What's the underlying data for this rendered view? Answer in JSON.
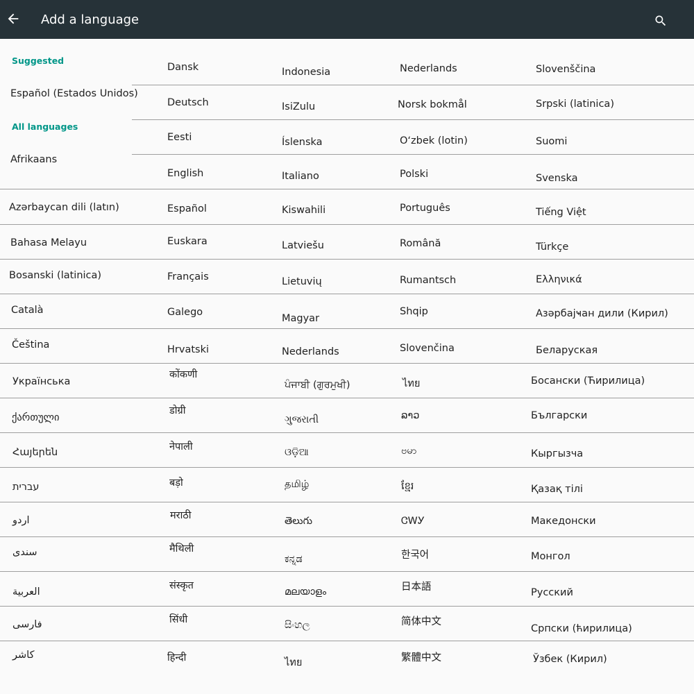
{
  "appbar": {
    "title": "Add a language",
    "back_icon": "arrow-back-icon",
    "search_icon": "search-icon",
    "background": "#263238"
  },
  "sections": {
    "suggested": "Suggested",
    "all": "All languages"
  },
  "suggested_items": [
    "Español (Estados Unidos)"
  ],
  "col0": [
    "Afrikaans",
    "Azərbaycan dili (latın)",
    "Bahasa Melayu",
    "Bosanski (latinica)",
    "Català",
    "Čeština",
    "Українська",
    "ქართული",
    "Հայերեն",
    "עברית",
    "اردو",
    "سندی",
    "العربية",
    "فارسی",
    "کاشر"
  ],
  "col1": [
    "Dansk",
    "Deutsch",
    "Eesti",
    "English",
    "Español",
    "Euskara",
    "Français",
    "Galego",
    "Hrvatski",
    "कोंकणी",
    "डोग्री",
    "नेपाली",
    "बड़ो",
    "मराठी",
    "मैथिली",
    "संस्कृत",
    "सिंधी",
    "हिन्दी"
  ],
  "col2": [
    "Indonesia",
    "IsiZulu",
    "Íslenska",
    "Italiano",
    "Kiswahili",
    "Latviešu",
    "Lietuvių",
    "Magyar",
    "Nederlands",
    "ਪੰਜਾਬੀ (ਗੁਰਮੁਖੀ)",
    "ગુજરાતી",
    "ଓଡ଼ିଆ",
    "தமிழ்",
    "తెలుగు",
    "ಕನ್ನಡ",
    "മലയാളം",
    "සිංහල",
    "ไทย"
  ],
  "col3": [
    "Nederlands",
    "Norsk bokmål",
    "O‘zbek (lotin)",
    "Polski",
    "Português",
    "Română",
    "Rumantsch",
    "Shqip",
    "Slovenčina",
    "ไทย",
    "ລາວ",
    "ဗမာ",
    "ខ្មែរ",
    "ᏣᎳᎩ",
    "한국어",
    "日本語",
    "简体中文",
    "繁體中文"
  ],
  "col4": [
    "Slovenščina",
    "Srpski (latinica)",
    "Suomi",
    "Svenska",
    "Tiếng Việt",
    "Türkçe",
    "Ελληνικά",
    "Азәрбајҹан дили (Кирил)",
    "Беларуская",
    "Босански (Ћирилица)",
    "Български",
    "Кыргызча",
    "Қазақ тілі",
    "Македонски",
    "Монгол",
    "Русский",
    "Српски (ћирилица)",
    "Ўзбек (Кирил)"
  ],
  "colors": {
    "accent": "#009688",
    "divider": "#9e9e9e",
    "background": "#fafafa"
  }
}
